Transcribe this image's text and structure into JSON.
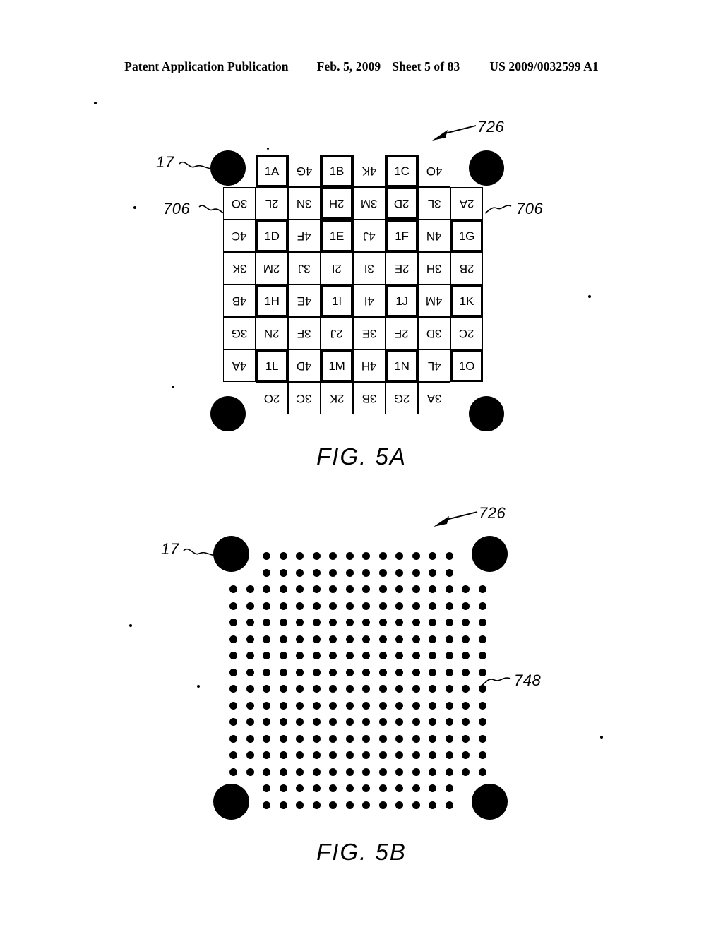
{
  "header": {
    "publication": "Patent Application Publication",
    "date": "Feb. 5, 2009",
    "sheet": "Sheet 5 of 83",
    "patent_number": "US 2009/0032599 A1"
  },
  "figures": [
    {
      "id": "fig5a",
      "caption": "FIG. 5A",
      "reference_labels": [
        {
          "name": "corner-dot-ref",
          "text": "17"
        },
        {
          "name": "tag-pattern-ref",
          "text": "726"
        },
        {
          "name": "macrodot-group-ref-left",
          "text": "706"
        },
        {
          "name": "macrodot-group-ref-right",
          "text": "706"
        }
      ],
      "grid": {
        "columns": 8,
        "rows": 8,
        "cell_size": 46,
        "rows_data": [
          {
            "offset": 1,
            "cells": [
              {
                "text": "1A",
                "flipped": false,
                "bold": true
              },
              {
                "text": "4G",
                "flipped": true,
                "bold": false
              },
              {
                "text": "1B",
                "flipped": false,
                "bold": true
              },
              {
                "text": "4K",
                "flipped": true,
                "bold": false
              },
              {
                "text": "1C",
                "flipped": false,
                "bold": true
              },
              {
                "text": "4O",
                "flipped": true,
                "bold": false
              }
            ]
          },
          {
            "offset": 0,
            "cells": [
              {
                "text": "3O",
                "flipped": true,
                "bold": false
              },
              {
                "text": "2L",
                "flipped": true,
                "bold": false
              },
              {
                "text": "3N",
                "flipped": true,
                "bold": false
              },
              {
                "text": "2H",
                "flipped": true,
                "bold": true
              },
              {
                "text": "3M",
                "flipped": true,
                "bold": false
              },
              {
                "text": "2D",
                "flipped": true,
                "bold": true
              },
              {
                "text": "3L",
                "flipped": true,
                "bold": false
              },
              {
                "text": "2A",
                "flipped": true,
                "bold": false
              }
            ]
          },
          {
            "offset": 0,
            "cells": [
              {
                "text": "4C",
                "flipped": true,
                "bold": false
              },
              {
                "text": "1D",
                "flipped": false,
                "bold": true
              },
              {
                "text": "4F",
                "flipped": true,
                "bold": false
              },
              {
                "text": "1E",
                "flipped": false,
                "bold": true
              },
              {
                "text": "4J",
                "flipped": true,
                "bold": false
              },
              {
                "text": "1F",
                "flipped": false,
                "bold": true
              },
              {
                "text": "4N",
                "flipped": true,
                "bold": false
              },
              {
                "text": "1G",
                "flipped": false,
                "bold": true
              }
            ]
          },
          {
            "offset": 0,
            "cells": [
              {
                "text": "3K",
                "flipped": true,
                "bold": false
              },
              {
                "text": "2M",
                "flipped": true,
                "bold": false
              },
              {
                "text": "3J",
                "flipped": true,
                "bold": false
              },
              {
                "text": "2I",
                "flipped": true,
                "bold": false
              },
              {
                "text": "3I",
                "flipped": true,
                "bold": false
              },
              {
                "text": "2E",
                "flipped": true,
                "bold": false
              },
              {
                "text": "3H",
                "flipped": true,
                "bold": false
              },
              {
                "text": "2B",
                "flipped": true,
                "bold": false
              }
            ]
          },
          {
            "offset": 0,
            "cells": [
              {
                "text": "4B",
                "flipped": true,
                "bold": false
              },
              {
                "text": "1H",
                "flipped": false,
                "bold": true
              },
              {
                "text": "4E",
                "flipped": true,
                "bold": false
              },
              {
                "text": "1I",
                "flipped": false,
                "bold": true
              },
              {
                "text": "4I",
                "flipped": true,
                "bold": false
              },
              {
                "text": "1J",
                "flipped": false,
                "bold": true
              },
              {
                "text": "4M",
                "flipped": true,
                "bold": false
              },
              {
                "text": "1K",
                "flipped": false,
                "bold": true
              }
            ]
          },
          {
            "offset": 0,
            "cells": [
              {
                "text": "3G",
                "flipped": true,
                "bold": false
              },
              {
                "text": "2N",
                "flipped": true,
                "bold": false
              },
              {
                "text": "3F",
                "flipped": true,
                "bold": false
              },
              {
                "text": "2J",
                "flipped": true,
                "bold": false
              },
              {
                "text": "3E",
                "flipped": true,
                "bold": false
              },
              {
                "text": "2F",
                "flipped": true,
                "bold": false
              },
              {
                "text": "3D",
                "flipped": true,
                "bold": false
              },
              {
                "text": "2C",
                "flipped": true,
                "bold": false
              }
            ]
          },
          {
            "offset": 0,
            "cells": [
              {
                "text": "4A",
                "flipped": true,
                "bold": false
              },
              {
                "text": "1L",
                "flipped": false,
                "bold": true
              },
              {
                "text": "4D",
                "flipped": true,
                "bold": false
              },
              {
                "text": "1M",
                "flipped": false,
                "bold": true
              },
              {
                "text": "4H",
                "flipped": true,
                "bold": false
              },
              {
                "text": "1N",
                "flipped": false,
                "bold": true
              },
              {
                "text": "4L",
                "flipped": true,
                "bold": false
              },
              {
                "text": "1O",
                "flipped": false,
                "bold": true
              }
            ]
          },
          {
            "offset": 1,
            "cells": [
              {
                "text": "2O",
                "flipped": true,
                "bold": false
              },
              {
                "text": "3C",
                "flipped": true,
                "bold": false
              },
              {
                "text": "2K",
                "flipped": true,
                "bold": false
              },
              {
                "text": "3B",
                "flipped": true,
                "bold": false
              },
              {
                "text": "2G",
                "flipped": true,
                "bold": false
              },
              {
                "text": "3A",
                "flipped": true,
                "bold": false
              }
            ]
          }
        ]
      }
    },
    {
      "id": "fig5b",
      "caption": "FIG. 5B",
      "reference_labels": [
        {
          "name": "corner-dot-ref",
          "text": "17"
        },
        {
          "name": "tag-pattern-ref",
          "text": "726"
        },
        {
          "name": "macrodot-ref",
          "text": "748"
        }
      ],
      "dot_matrix": {
        "columns": 16,
        "rows": 16,
        "pitch": 23.5,
        "dot_diameter": 11,
        "row_spans": [
          {
            "start": 2,
            "count": 12
          },
          {
            "start": 2,
            "count": 12
          },
          {
            "start": 0,
            "count": 16
          },
          {
            "start": 0,
            "count": 16
          },
          {
            "start": 0,
            "count": 16
          },
          {
            "start": 0,
            "count": 16
          },
          {
            "start": 0,
            "count": 16
          },
          {
            "start": 0,
            "count": 16
          },
          {
            "start": 0,
            "count": 16
          },
          {
            "start": 0,
            "count": 16
          },
          {
            "start": 0,
            "count": 16
          },
          {
            "start": 0,
            "count": 16
          },
          {
            "start": 0,
            "count": 16
          },
          {
            "start": 0,
            "count": 16
          },
          {
            "start": 2,
            "count": 12
          },
          {
            "start": 2,
            "count": 12
          }
        ]
      }
    }
  ],
  "colors": {
    "ink": "#000000",
    "paper": "#ffffff"
  }
}
